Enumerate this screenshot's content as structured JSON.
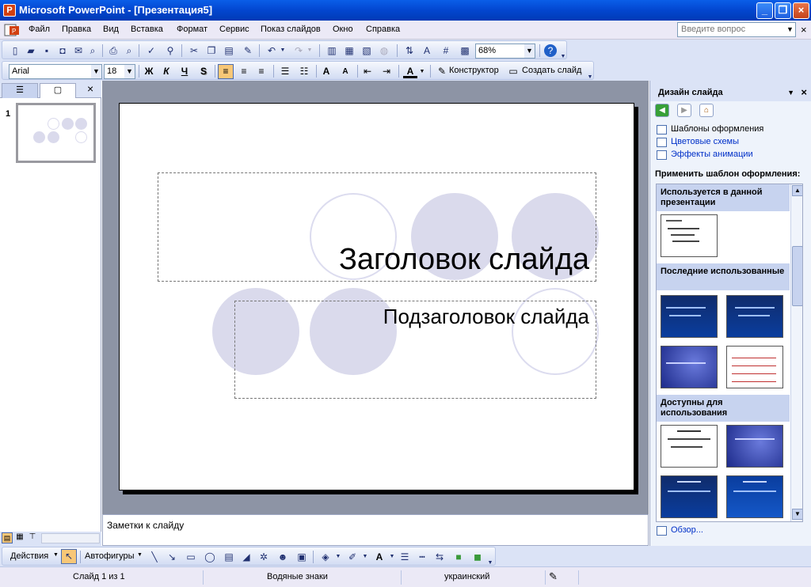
{
  "window": {
    "title": "Microsoft PowerPoint - [Презентация5]",
    "minimize_glyph": "_",
    "maximize_glyph": "❐",
    "close_glyph": "×"
  },
  "menu": {
    "items": [
      "Файл",
      "Правка",
      "Вид",
      "Вставка",
      "Формат",
      "Сервис",
      "Показ слайдов",
      "Окно",
      "Справка"
    ],
    "help_placeholder": "Введите вопрос",
    "close_doc_glyph": "×"
  },
  "standard_toolbar": {
    "zoom": "68%"
  },
  "formatting_toolbar": {
    "font": "Arial",
    "font_size": "18",
    "bold": "Ж",
    "italic": "К",
    "underline": "Ч",
    "shadow": "S",
    "designer_label": "Конструктор",
    "new_slide_label": "Создать слайд"
  },
  "left_pane": {
    "close_glyph": "×",
    "slide_number": "1"
  },
  "slide": {
    "title": "Заголовок слайда",
    "subtitle": "Подзаголовок слайда",
    "circle_color": "#dadaec",
    "circle_outline": "#dcdcef"
  },
  "notes": {
    "placeholder": "Заметки к слайду"
  },
  "task_pane": {
    "title": "Дизайн слайда",
    "links": [
      "Шаблоны оформления",
      "Цветовые схемы",
      "Эффекты анимации"
    ],
    "apply_label": "Применить шаблон оформления:",
    "sections": [
      "Используется в данной презентации",
      "Последние использованные",
      "Доступны для использования"
    ],
    "browse": "Обзор..."
  },
  "drawing_toolbar": {
    "actions": "Действия",
    "autoshapes": "Автофигуры"
  },
  "status": {
    "slide": "Слайд 1 из 1",
    "design": "Водяные знаки",
    "language": "украинский"
  },
  "colors": {
    "title_bar": "#0a5ee8",
    "toolbar": "#dbe3f6",
    "work_area": "#8d94a5"
  }
}
